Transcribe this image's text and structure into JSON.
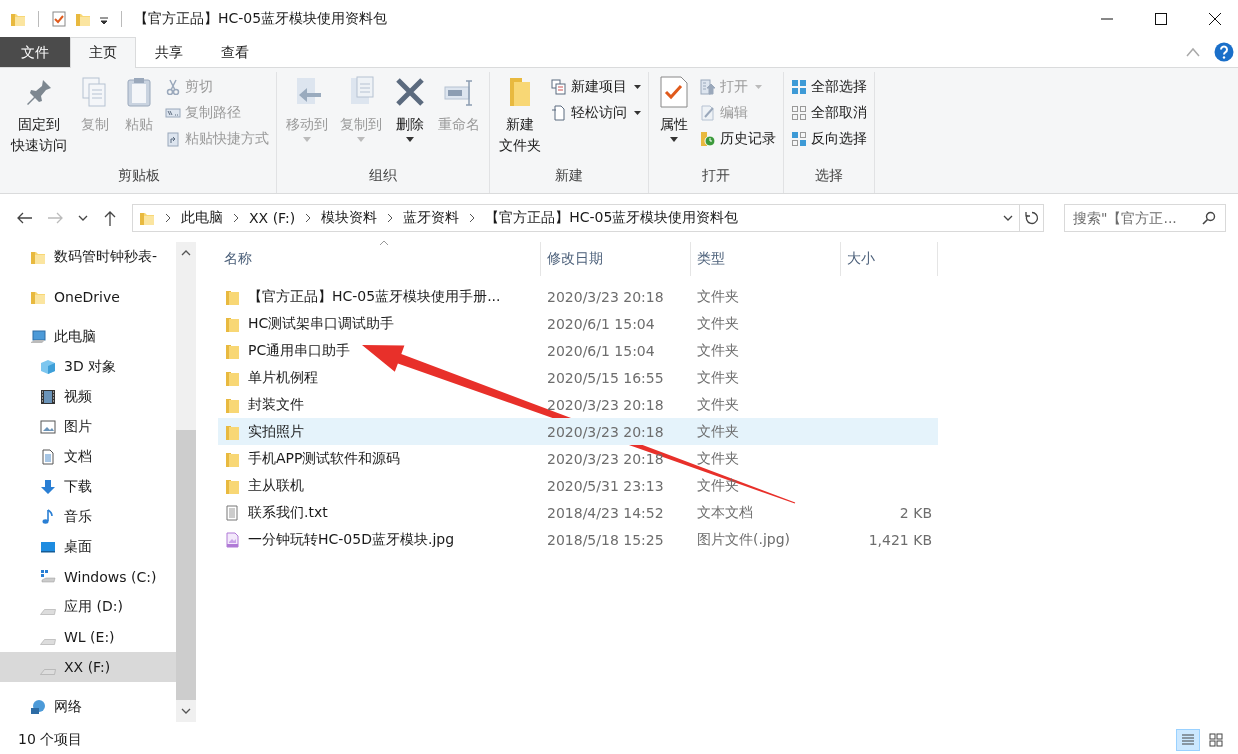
{
  "window": {
    "title": "【官方正品】HC-05蓝牙模块使用资料包"
  },
  "ribbon_tabs": [
    {
      "label": "文件",
      "kind": "file",
      "selected": false
    },
    {
      "label": "主页",
      "kind": "tab",
      "selected": true
    },
    {
      "label": "共享",
      "kind": "tab",
      "selected": false
    },
    {
      "label": "查看",
      "kind": "tab",
      "selected": false
    }
  ],
  "ribbon_groups": [
    {
      "label": "剪贴板",
      "commands": [
        {
          "lines": [
            "固定到",
            "快速访问"
          ],
          "kind": "large",
          "disabled": false,
          "dropdown": false
        },
        {
          "label": "复制",
          "kind": "large",
          "disabled": true,
          "dropdown": false
        },
        {
          "label": "粘贴",
          "kind": "large",
          "disabled": true,
          "dropdown": false
        },
        {
          "label": "剪切",
          "kind": "small",
          "disabled": true,
          "dropdown": false
        },
        {
          "label": "复制路径",
          "kind": "small",
          "disabled": true,
          "dropdown": false
        },
        {
          "label": "粘贴快捷方式",
          "kind": "small",
          "disabled": true,
          "dropdown": false
        }
      ]
    },
    {
      "label": "组织",
      "commands": [
        {
          "label": "移动到",
          "kind": "large",
          "disabled": true,
          "dropdown": true
        },
        {
          "label": "复制到",
          "kind": "large",
          "disabled": true,
          "dropdown": true
        },
        {
          "label": "删除",
          "kind": "large",
          "disabled": false,
          "dropdown": true
        },
        {
          "label": "重命名",
          "kind": "large",
          "disabled": true,
          "dropdown": false
        }
      ]
    },
    {
      "label": "新建",
      "commands": [
        {
          "lines": [
            "新建",
            "文件夹"
          ],
          "kind": "large",
          "disabled": false,
          "dropdown": false
        },
        {
          "label": "新建项目",
          "kind": "small",
          "disabled": false,
          "dropdown": true
        },
        {
          "label": "轻松访问",
          "kind": "small",
          "disabled": false,
          "dropdown": true
        }
      ]
    },
    {
      "label": "打开",
      "commands": [
        {
          "label": "属性",
          "kind": "large",
          "disabled": false,
          "dropdown": true
        },
        {
          "label": "打开",
          "kind": "small",
          "disabled": true,
          "dropdown": true
        },
        {
          "label": "编辑",
          "kind": "small",
          "disabled": true,
          "dropdown": false
        },
        {
          "label": "历史记录",
          "kind": "small",
          "disabled": false,
          "dropdown": false
        }
      ]
    },
    {
      "label": "选择",
      "commands": [
        {
          "label": "全部选择",
          "kind": "small",
          "disabled": false,
          "dropdown": false
        },
        {
          "label": "全部取消",
          "kind": "small",
          "disabled": false,
          "dropdown": false
        },
        {
          "label": "反向选择",
          "kind": "small",
          "disabled": false,
          "dropdown": false
        }
      ]
    }
  ],
  "address_bar": {
    "path": [
      "此电脑",
      "XX (F:)",
      "模块资料",
      "蓝牙资料",
      "【官方正品】HC-05蓝牙模块使用资料包"
    ]
  },
  "search": {
    "placeholder": "搜索\"【官方正..."
  },
  "sidebar": {
    "items": [
      {
        "label": "数码管时钟秒表-",
        "kind": "folder",
        "selected": false
      },
      {
        "label": "OneDrive",
        "kind": "onedrive",
        "selected": false
      },
      {
        "label": "此电脑",
        "kind": "pc",
        "selected": false,
        "children": [
          {
            "label": "3D 对象",
            "kind": "cube",
            "selected": false
          },
          {
            "label": "视频",
            "kind": "video",
            "selected": false
          },
          {
            "label": "图片",
            "kind": "pictures",
            "selected": false
          },
          {
            "label": "文档",
            "kind": "document",
            "selected": false
          },
          {
            "label": "下载",
            "kind": "download",
            "selected": false
          },
          {
            "label": "音乐",
            "kind": "music",
            "selected": false
          },
          {
            "label": "桌面",
            "kind": "desktop",
            "selected": false
          },
          {
            "label": "Windows (C:)",
            "kind": "system-drive",
            "selected": false
          },
          {
            "label": "应用 (D:)",
            "kind": "drive",
            "selected": false
          },
          {
            "label": "WL (E:)",
            "kind": "drive",
            "selected": false
          },
          {
            "label": "XX (F:)",
            "kind": "drive",
            "selected": true
          }
        ]
      },
      {
        "label": "网络",
        "kind": "network",
        "selected": false
      }
    ]
  },
  "file_list": {
    "columns": [
      {
        "label": "名称",
        "sorted": true
      },
      {
        "label": "修改日期",
        "sorted": false
      },
      {
        "label": "类型",
        "sorted": false
      },
      {
        "label": "大小",
        "sorted": false
      }
    ],
    "rows": [
      {
        "name": "【官方正品】HC-05蓝牙模块使用手册...",
        "date": "2020/3/23 20:18",
        "type": "文件夹",
        "kind": "folder",
        "hovered": false
      },
      {
        "name": "HC测试架串口调试助手",
        "date": "2020/6/1 15:04",
        "type": "文件夹",
        "kind": "folder",
        "hovered": false
      },
      {
        "name": "PC通用串口助手",
        "date": "2020/6/1 15:04",
        "type": "文件夹",
        "kind": "folder",
        "hovered": false
      },
      {
        "name": "单片机例程",
        "date": "2020/5/15 16:55",
        "type": "文件夹",
        "kind": "folder",
        "hovered": false
      },
      {
        "name": "封装文件",
        "date": "2020/3/23 20:18",
        "type": "文件夹",
        "kind": "folder",
        "hovered": false
      },
      {
        "name": "实拍照片",
        "date": "2020/3/23 20:18",
        "type": "文件夹",
        "kind": "folder",
        "hovered": true
      },
      {
        "name": "手机APP测试软件和源码",
        "date": "2020/3/23 20:18",
        "type": "文件夹",
        "kind": "folder",
        "hovered": false
      },
      {
        "name": "主从联机",
        "date": "2020/5/31 23:13",
        "type": "文件夹",
        "kind": "folder",
        "hovered": false
      },
      {
        "name": "联系我们.txt",
        "date": "2018/4/23 14:52",
        "type": "文本文档",
        "size": "2 KB",
        "kind": "text",
        "hovered": false
      },
      {
        "name": "一分钟玩转HC-05D蓝牙模块.jpg",
        "date": "2018/5/18 15:25",
        "type": "图片文件(.jpg)",
        "size": "1,421 KB",
        "kind": "image",
        "hovered": false
      }
    ]
  },
  "status_bar": {
    "item_count": "10 个项目",
    "views": [
      {
        "kind": "details",
        "selected": true
      },
      {
        "kind": "large-icons",
        "selected": false
      }
    ]
  }
}
